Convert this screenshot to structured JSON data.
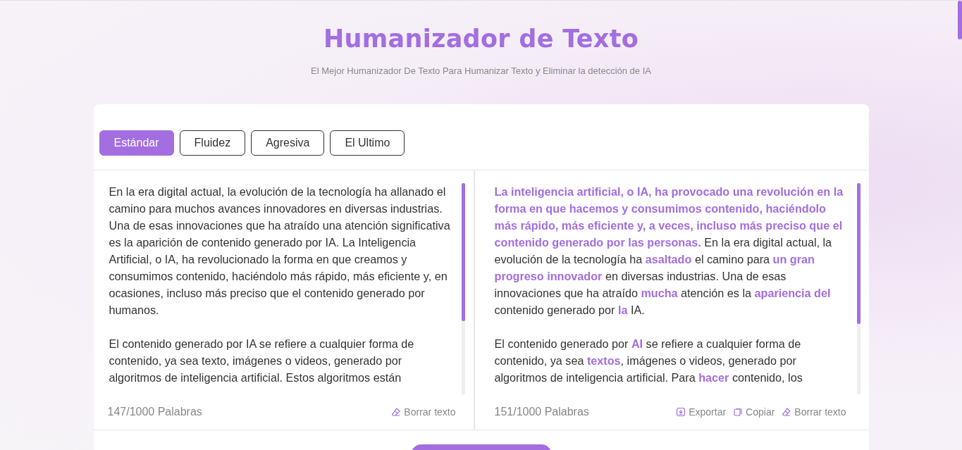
{
  "header": {
    "title": "Humanizador de Texto",
    "subtitle": "El Mejor Humanizador De Texto Para Humanizar Texto y Eliminar la detección de IA"
  },
  "modes": [
    {
      "label": "Estándar",
      "selected": true
    },
    {
      "label": "Fluidez",
      "selected": false
    },
    {
      "label": "Agresiva",
      "selected": false
    },
    {
      "label": "El Ultimo",
      "selected": false
    }
  ],
  "input": {
    "paragraphs": [
      "En la era digital actual, la evolución de la tecnología ha allanado el camino para muchos avances innovadores en diversas industrias. Una de esas innovaciones que ha atraído una atención significativa es la aparición de contenido generado por IA. La Inteligencia Artificial, o IA, ha revolucionado la forma en que creamos y consumimos contenido, haciéndolo más rápido, más eficiente y, en ocasiones, incluso más preciso que el contenido generado por humanos.",
      "El contenido generado por IA se refiere a cualquier forma de contenido, ya sea texto, imágenes o videos, generado por algoritmos de inteligencia artificial. Estos algoritmos están"
    ],
    "word_count": "147/1000 Palabras",
    "actions": [
      {
        "kind": "clear",
        "label": "Borrar texto"
      }
    ]
  },
  "output": {
    "paragraphs": [
      [
        {
          "text": "La inteligencia artificial, o IA, ha provocado una revolución en la forma en que hacemos y consumimos contenido, haciéndolo más rápido, más eficiente y, a veces, incluso más preciso que el contenido generado por las personas.",
          "highlighted": true
        },
        {
          "text": " En la era digital actual, la evolución de la tecnología ha ",
          "highlighted": false
        },
        {
          "text": "asaltado",
          "highlighted": true
        },
        {
          "text": " el camino para ",
          "highlighted": false
        },
        {
          "text": "un gran progreso innovador",
          "highlighted": true
        },
        {
          "text": " en diversas industrias. Una de esas innovaciones que ha atraído ",
          "highlighted": false
        },
        {
          "text": "mucha",
          "highlighted": true
        },
        {
          "text": " atención es la ",
          "highlighted": false
        },
        {
          "text": "apariencia del",
          "highlighted": true
        },
        {
          "text": " contenido generado por ",
          "highlighted": false
        },
        {
          "text": "la",
          "highlighted": true
        },
        {
          "text": " IA.",
          "highlighted": false
        }
      ],
      [
        {
          "text": "El contenido generado por ",
          "highlighted": false
        },
        {
          "text": "AI",
          "highlighted": true
        },
        {
          "text": " se refiere a cualquier forma de contenido, ya sea ",
          "highlighted": false
        },
        {
          "text": "textos",
          "highlighted": true
        },
        {
          "text": ", imágenes o videos, generado por algoritmos de inteligencia artificial. Para ",
          "highlighted": false
        },
        {
          "text": "hacer",
          "highlighted": true
        },
        {
          "text": " contenido, los",
          "highlighted": false
        }
      ]
    ],
    "word_count": "151/1000 Palabras",
    "actions": [
      {
        "kind": "export",
        "label": "Exportar"
      },
      {
        "kind": "copy",
        "label": "Copiar"
      },
      {
        "kind": "clear",
        "label": "Borrar texto"
      }
    ]
  }
}
